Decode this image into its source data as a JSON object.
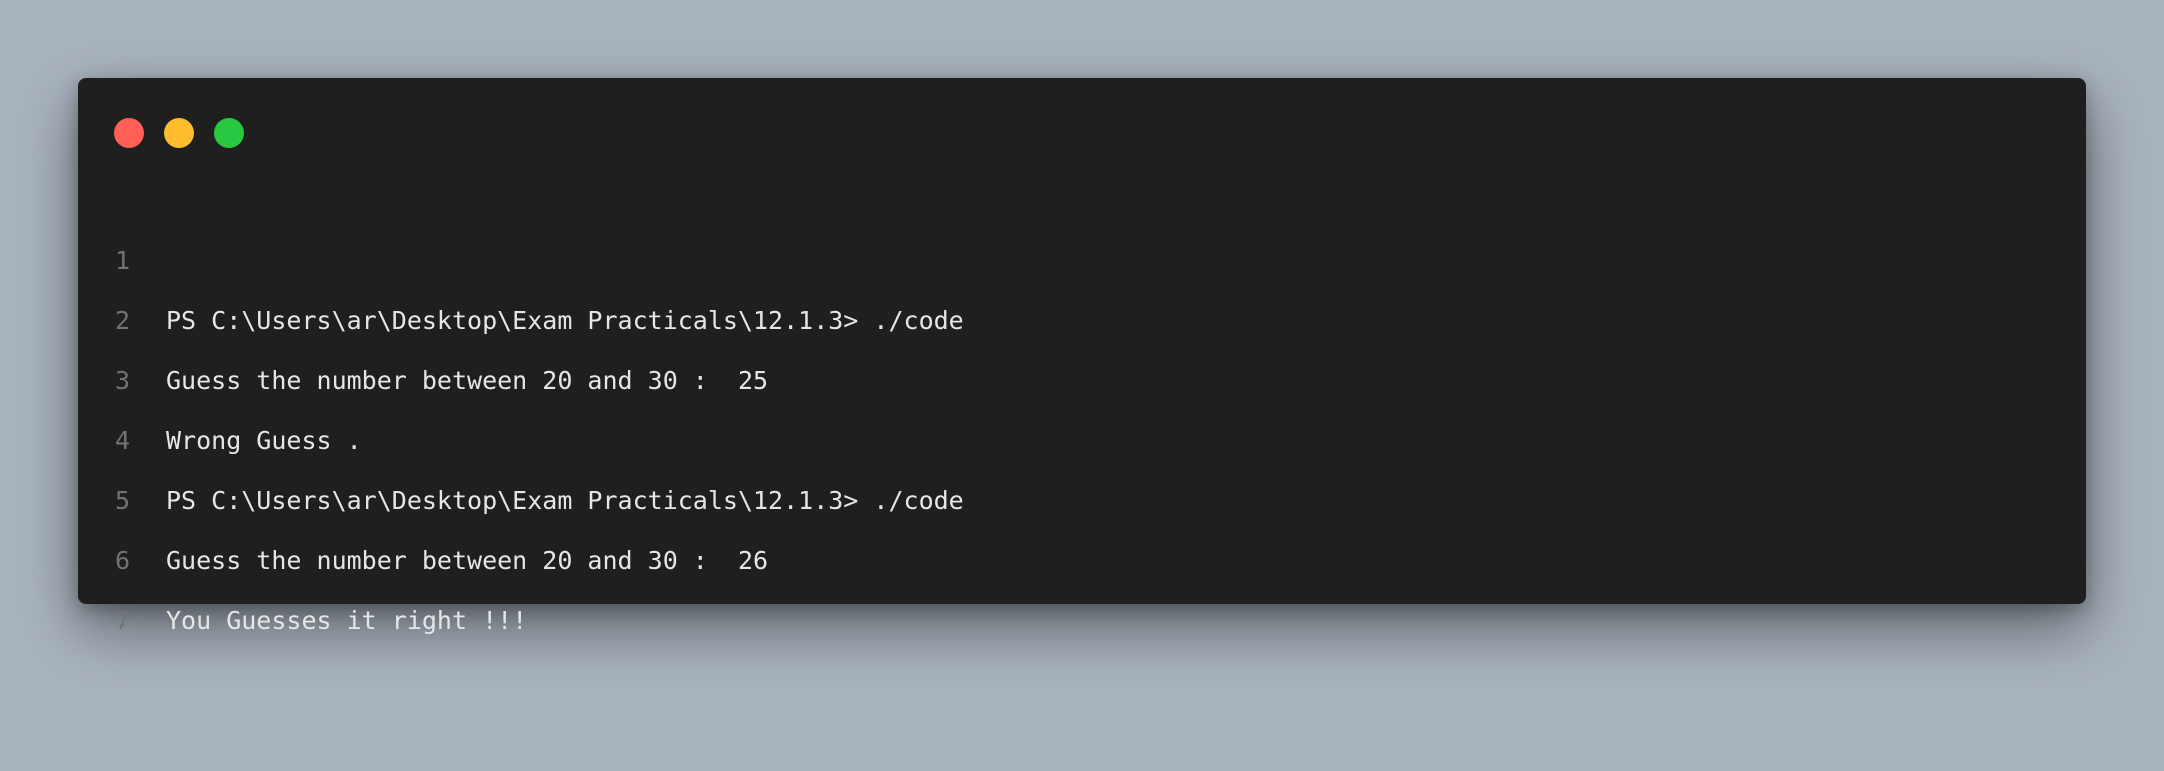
{
  "window": {
    "controls": [
      {
        "name": "close",
        "color": "#ff5f57"
      },
      {
        "name": "minimize",
        "color": "#febc2e"
      },
      {
        "name": "maximize",
        "color": "#28c840"
      }
    ]
  },
  "code": {
    "lines": [
      {
        "number": "1",
        "text": "PS C:\\Users\\ar\\Desktop\\Exam Practicals\\12.1.3> ./code"
      },
      {
        "number": "2",
        "text": "Guess the number between 20 and 30 :  25"
      },
      {
        "number": "3",
        "text": "Wrong Guess ."
      },
      {
        "number": "4",
        "text": "PS C:\\Users\\ar\\Desktop\\Exam Practicals\\12.1.3> ./code"
      },
      {
        "number": "5",
        "text": "Guess the number between 20 and 30 :  26"
      },
      {
        "number": "6",
        "text": "You Guesses it right !!!"
      },
      {
        "number": "7",
        "text": ""
      }
    ]
  }
}
